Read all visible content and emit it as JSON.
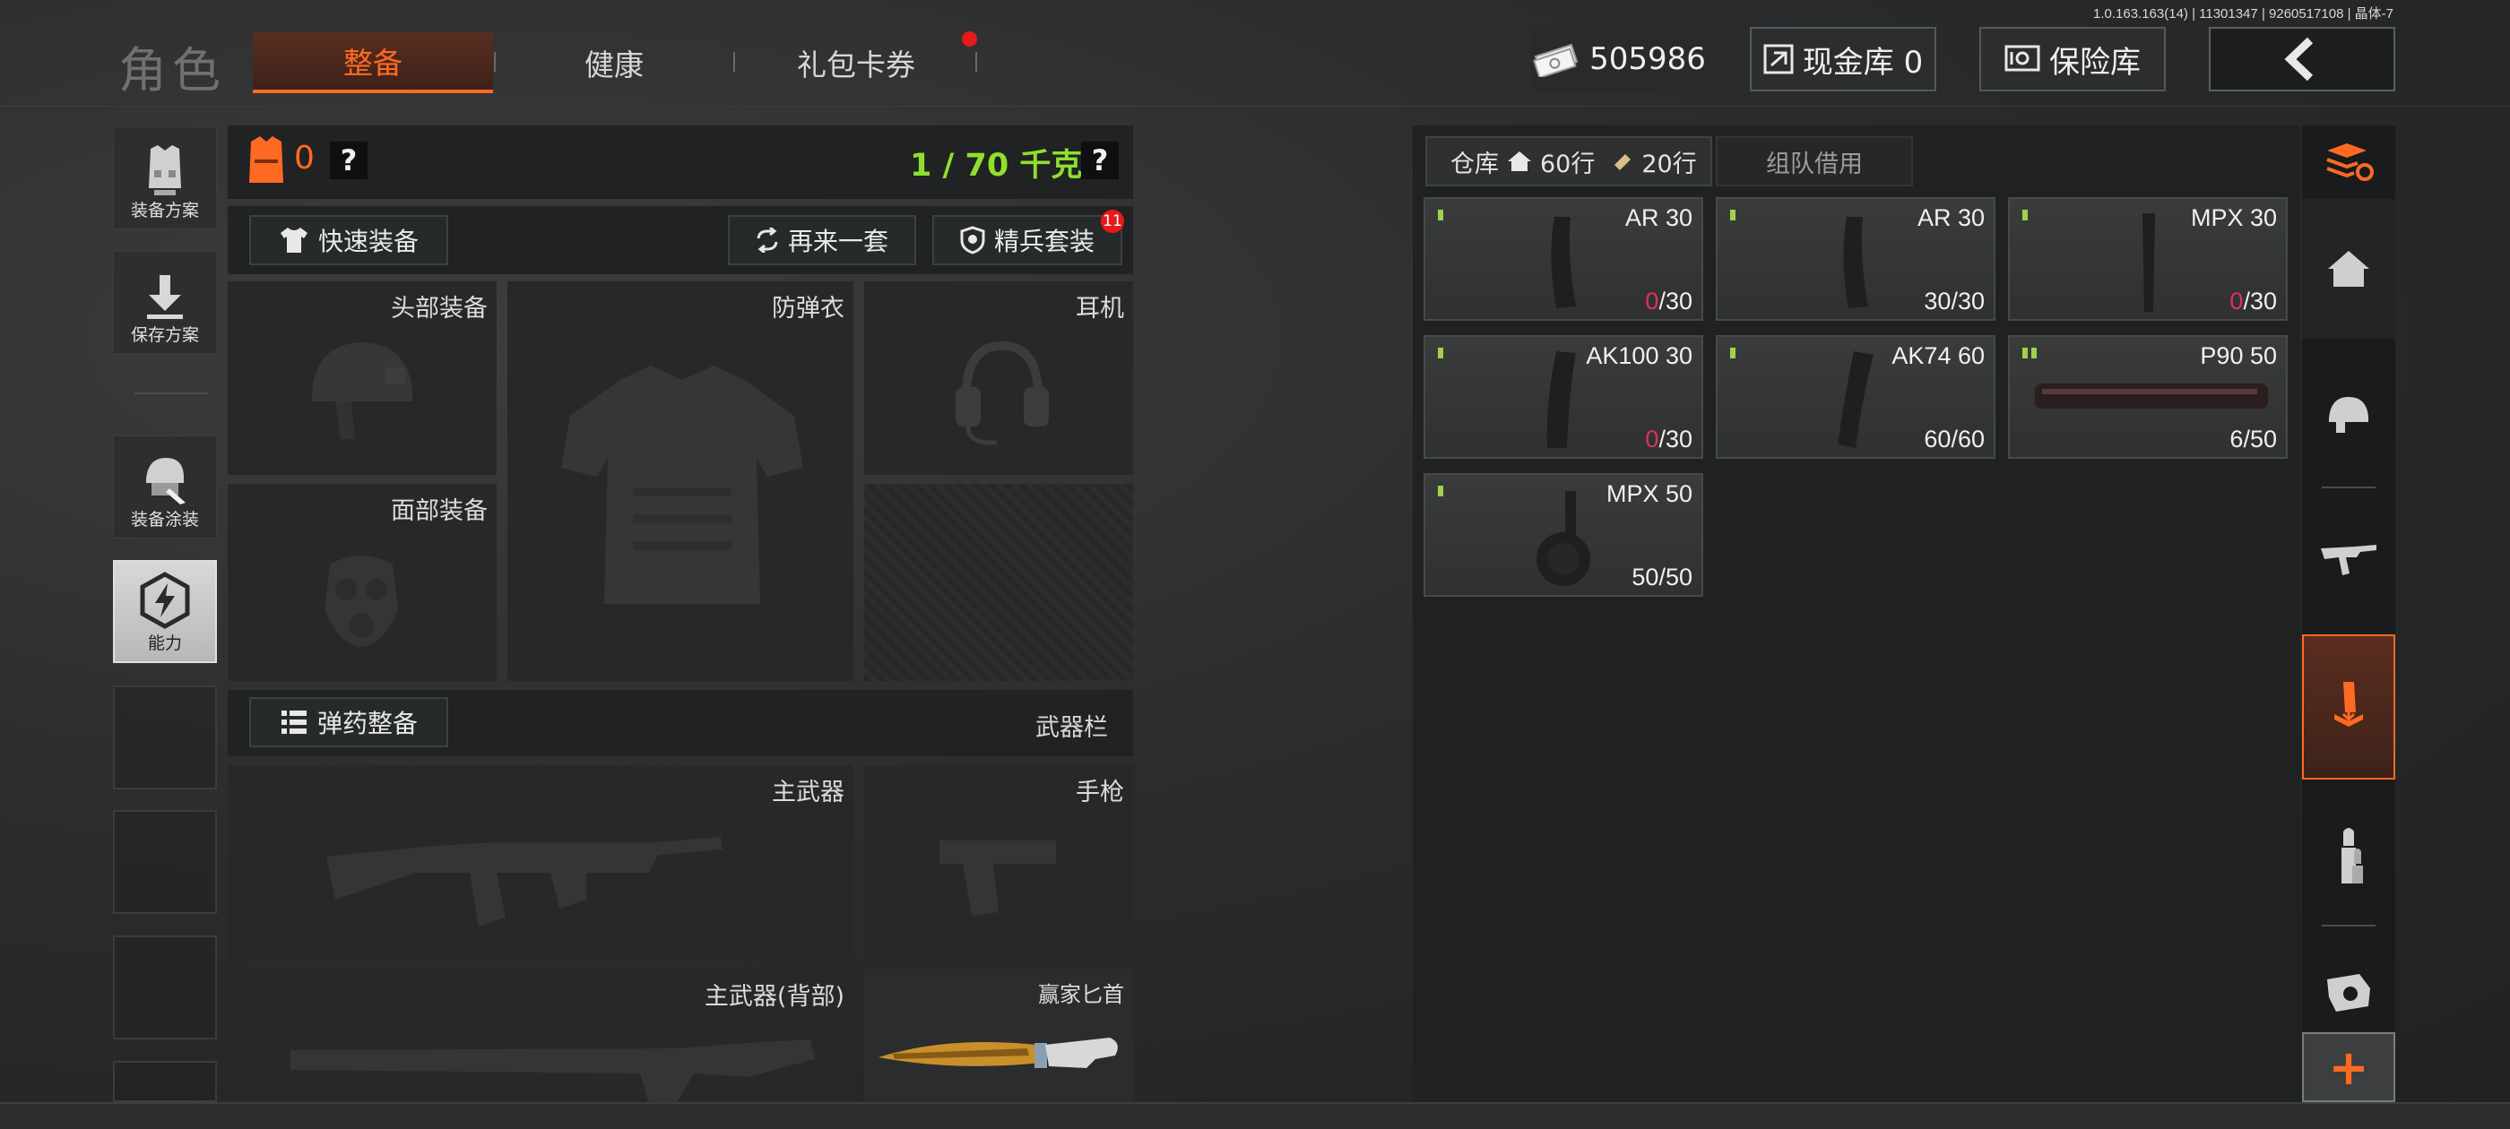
{
  "version": "1.0.163.163(14) | 11301347 | 9260517108 | 晶体-7",
  "header": {
    "title": "角色",
    "tabs": [
      {
        "label": "整备",
        "active": true
      },
      {
        "label": "健康",
        "active": false
      },
      {
        "label": "礼包卡券",
        "active": false,
        "has_notification": true
      }
    ],
    "money": "505986",
    "cash_vault": "现金库 0",
    "safe_vault": "保险库"
  },
  "sidebar": {
    "items": [
      {
        "label": "装备方案",
        "icon": "vest-plan-icon"
      },
      {
        "label": "保存方案",
        "icon": "download-icon"
      },
      {
        "label": "装备涂装",
        "icon": "helmet-paint-icon"
      },
      {
        "label": "能力",
        "icon": "lightning-icon",
        "active": true
      }
    ]
  },
  "equipment": {
    "armor_count": "0",
    "help": "?",
    "weight": "1 / 70 千克",
    "quick_equip": "快速装备",
    "reroll": "再来一套",
    "elite_set": "精兵套装",
    "elite_badge": "11",
    "slots": {
      "head": "头部装备",
      "armor": "防弹衣",
      "headset": "耳机",
      "face": "面部装备"
    },
    "ammo_equip": "弹药整备",
    "weapon_bar": "武器栏",
    "weapons": {
      "primary": "主武器",
      "pistol": "手枪",
      "primary_back": "主武器(背部)",
      "melee": "赢家匕首"
    }
  },
  "storage": {
    "tabs": [
      {
        "label": "仓库",
        "rows_home": "60行",
        "rows_ticket": "20行",
        "active": true
      },
      {
        "label": "组队借用",
        "active": false
      }
    ],
    "items": [
      {
        "name": "AR 30",
        "count_current": "0",
        "count_max": "/30",
        "empty": true,
        "marks": 1
      },
      {
        "name": "AR 30",
        "count_current": "30",
        "count_max": "/30",
        "empty": false,
        "marks": 1
      },
      {
        "name": "MPX 30",
        "count_current": "0",
        "count_max": "/30",
        "empty": true,
        "marks": 1
      },
      {
        "name": "AK100 30",
        "count_current": "0",
        "count_max": "/30",
        "empty": true,
        "marks": 1
      },
      {
        "name": "AK74 60",
        "count_current": "60",
        "count_max": "/60",
        "empty": false,
        "marks": 1
      },
      {
        "name": "P90 50",
        "count_current": "6",
        "count_max": "/50",
        "empty": false,
        "marks": 2
      },
      {
        "name": "MPX 50",
        "count_current": "50",
        "count_max": "/50",
        "empty": false,
        "marks": 1
      }
    ]
  },
  "right_sidebar": {
    "icons": [
      "stack-refresh-icon",
      "home-icon",
      "helmet-icon",
      "rifle-icon",
      "magazine-icon",
      "bullet-icon",
      "scope-icon"
    ],
    "active": "magazine-icon",
    "add_label": "+"
  },
  "colors": {
    "accent": "#ff6a22",
    "weight_green": "#8ee02c",
    "empty_red": "#e0305a",
    "notify_red": "#e6191b"
  }
}
